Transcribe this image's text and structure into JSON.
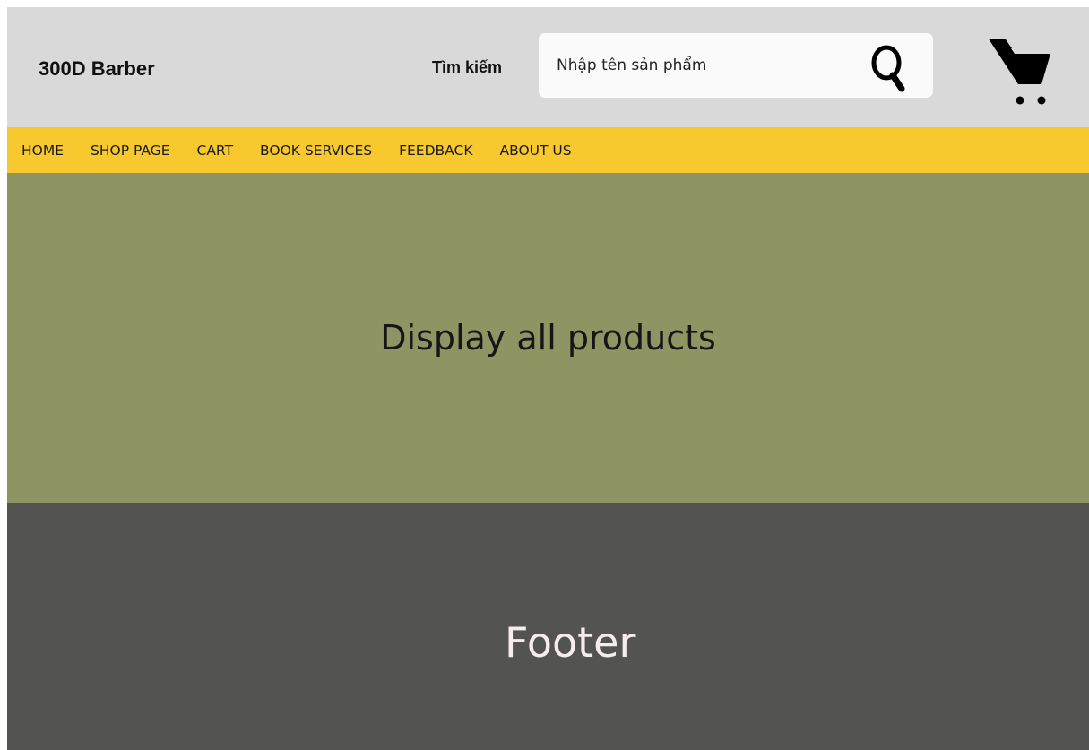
{
  "header": {
    "brand": "300D Barber",
    "search_label": "Tìm kiếm",
    "search_placeholder": "Nhập tên sản phẩm",
    "search_value": "",
    "icons": {
      "search": "search-icon",
      "cart": "cart-icon"
    }
  },
  "nav": {
    "items": [
      {
        "label": "HOME"
      },
      {
        "label": "SHOP PAGE"
      },
      {
        "label": "CART"
      },
      {
        "label": "BOOK SERVICES"
      },
      {
        "label": "FEEDBACK"
      },
      {
        "label": "ABOUT US"
      }
    ]
  },
  "main": {
    "products_text": "Display all products"
  },
  "footer": {
    "text": "Footer"
  },
  "colors": {
    "header_bg": "#d9d9d9",
    "nav_bg": "#f7c92e",
    "products_bg": "#8e9462",
    "footer_bg": "#535351",
    "footer_text": "#f6ecec"
  }
}
